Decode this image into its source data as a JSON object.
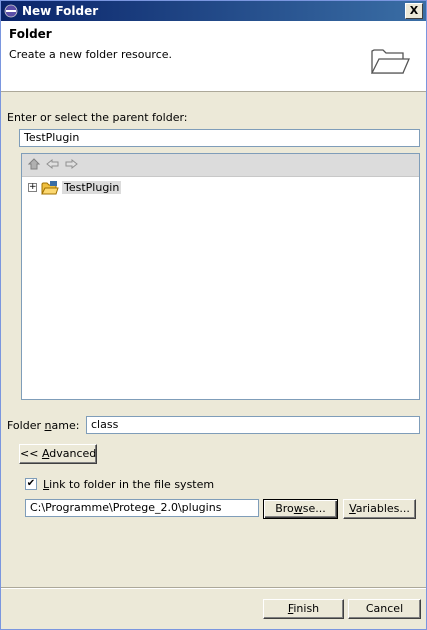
{
  "window": {
    "title": "New Folder",
    "close_label": "X"
  },
  "header": {
    "title": "Folder",
    "description": "Create a new folder resource."
  },
  "parent": {
    "label": "Enter or select the parent folder:",
    "value": "TestPlugin"
  },
  "tree": {
    "items": [
      {
        "label": "TestPlugin",
        "expander": "+"
      }
    ]
  },
  "folder_name": {
    "label": "Folder name:",
    "value": "class"
  },
  "advanced_button": "<< Advanced",
  "link": {
    "checkbox_label": "Link to folder in the file system",
    "checked": true,
    "check_mark": "✔",
    "path_value": "C:\\Programme\\Protege_2.0\\plugins",
    "browse_label": "Browse...",
    "variables_label": "Variables..."
  },
  "footer": {
    "finish_label": "Finish",
    "cancel_label": "Cancel"
  }
}
